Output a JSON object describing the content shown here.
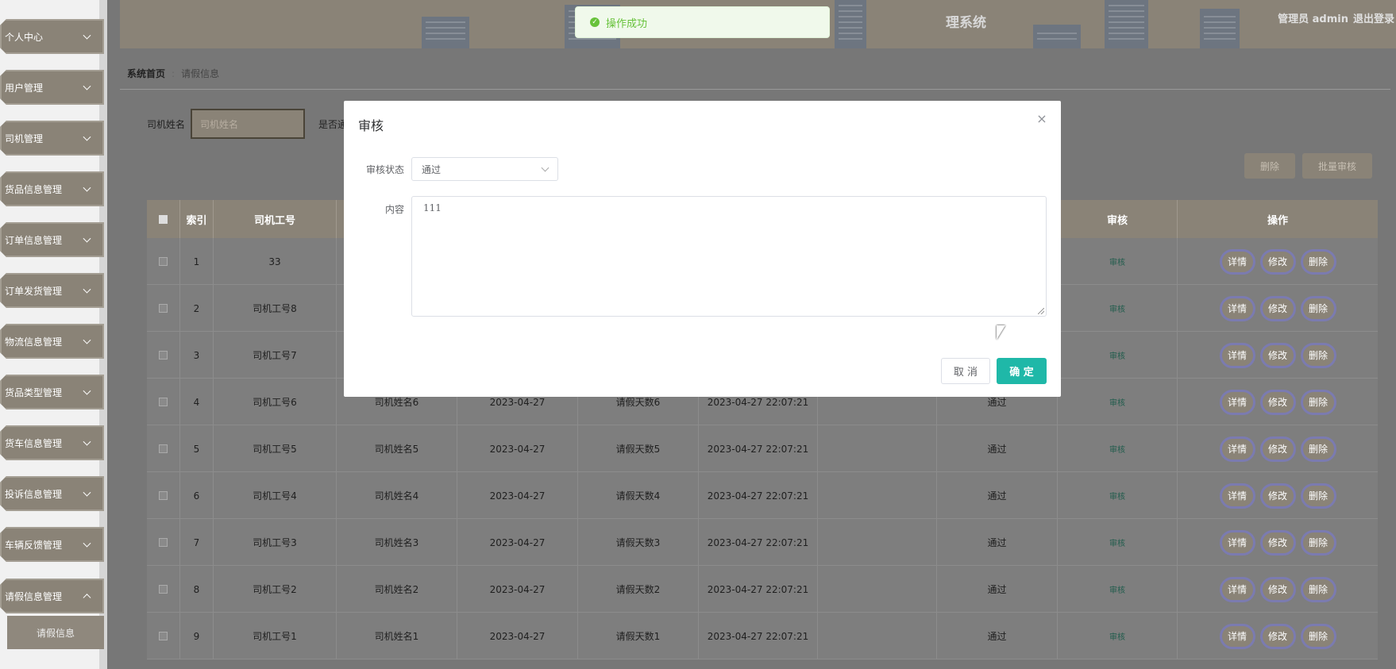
{
  "sidebar": {
    "items": [
      {
        "label": "个人中心"
      },
      {
        "label": "用户管理"
      },
      {
        "label": "司机管理"
      },
      {
        "label": "货品信息管理"
      },
      {
        "label": "订单信息管理"
      },
      {
        "label": "订单发货管理"
      },
      {
        "label": "物流信息管理"
      },
      {
        "label": "货品类型管理"
      },
      {
        "label": "货车信息管理"
      },
      {
        "label": "投诉信息管理"
      },
      {
        "label": "车辆反馈管理"
      },
      {
        "label": "请假信息管理"
      }
    ],
    "submenu_label": "请假信息"
  },
  "header": {
    "site_title": "理系统",
    "user_text": "管理员 admin",
    "logout_label": "退出登录"
  },
  "breadcrumb": {
    "home": "系统首页",
    "separator": ":",
    "current": "请假信息"
  },
  "search": {
    "driver_name_label": "司机姓名",
    "driver_name_placeholder": "司机姓名",
    "passed_label": "是否通过"
  },
  "toolbar": {
    "delete_label": "删除",
    "batch_audit_label": "批量审核"
  },
  "table": {
    "headers": {
      "index": "索引",
      "driver_no": "司机工号",
      "audit": "审核",
      "actions": "操作"
    },
    "rows": [
      {
        "index": "1",
        "driver_no": "33",
        "driver_name": "",
        "date": "",
        "days": "",
        "time": "",
        "status": "",
        "audit": "审核"
      },
      {
        "index": "2",
        "driver_no": "司机工号8",
        "driver_name": "",
        "date": "",
        "days": "",
        "time": "",
        "status": "",
        "audit": "审核"
      },
      {
        "index": "3",
        "driver_no": "司机工号7",
        "driver_name": "",
        "date": "",
        "days": "",
        "time": "",
        "status": "",
        "audit": "审核"
      },
      {
        "index": "4",
        "driver_no": "司机工号6",
        "driver_name": "司机姓名6",
        "date": "2023-04-27",
        "days": "请假天数6",
        "time": "2023-04-27 22:07:21",
        "status": "通过",
        "audit": "审核"
      },
      {
        "index": "5",
        "driver_no": "司机工号5",
        "driver_name": "司机姓名5",
        "date": "2023-04-27",
        "days": "请假天数5",
        "time": "2023-04-27 22:07:21",
        "status": "通过",
        "audit": "审核"
      },
      {
        "index": "6",
        "driver_no": "司机工号4",
        "driver_name": "司机姓名4",
        "date": "2023-04-27",
        "days": "请假天数4",
        "time": "2023-04-27 22:07:21",
        "status": "通过",
        "audit": "审核"
      },
      {
        "index": "7",
        "driver_no": "司机工号3",
        "driver_name": "司机姓名3",
        "date": "2023-04-27",
        "days": "请假天数3",
        "time": "2023-04-27 22:07:21",
        "status": "通过",
        "audit": "审核"
      },
      {
        "index": "8",
        "driver_no": "司机工号2",
        "driver_name": "司机姓名2",
        "date": "2023-04-27",
        "days": "请假天数2",
        "time": "2023-04-27 22:07:21",
        "status": "通过",
        "audit": "审核"
      },
      {
        "index": "9",
        "driver_no": "司机工号1",
        "driver_name": "司机姓名1",
        "date": "2023-04-27",
        "days": "请假天数1",
        "time": "2023-04-27 22:07:21",
        "status": "通过",
        "audit": "审核"
      }
    ],
    "actions": {
      "detail": "详情",
      "edit": "修改",
      "delete": "删除"
    }
  },
  "toast": {
    "message": "操作成功",
    "icon": "check-circle-icon",
    "color": "#67c23a"
  },
  "dialog": {
    "title": "审核",
    "status_label": "审核状态",
    "status_value": "通过",
    "content_label": "内容",
    "content_value": "111",
    "cancel_label": "取 消",
    "confirm_label": "确 定",
    "accent_color": "#1fb8a8"
  }
}
